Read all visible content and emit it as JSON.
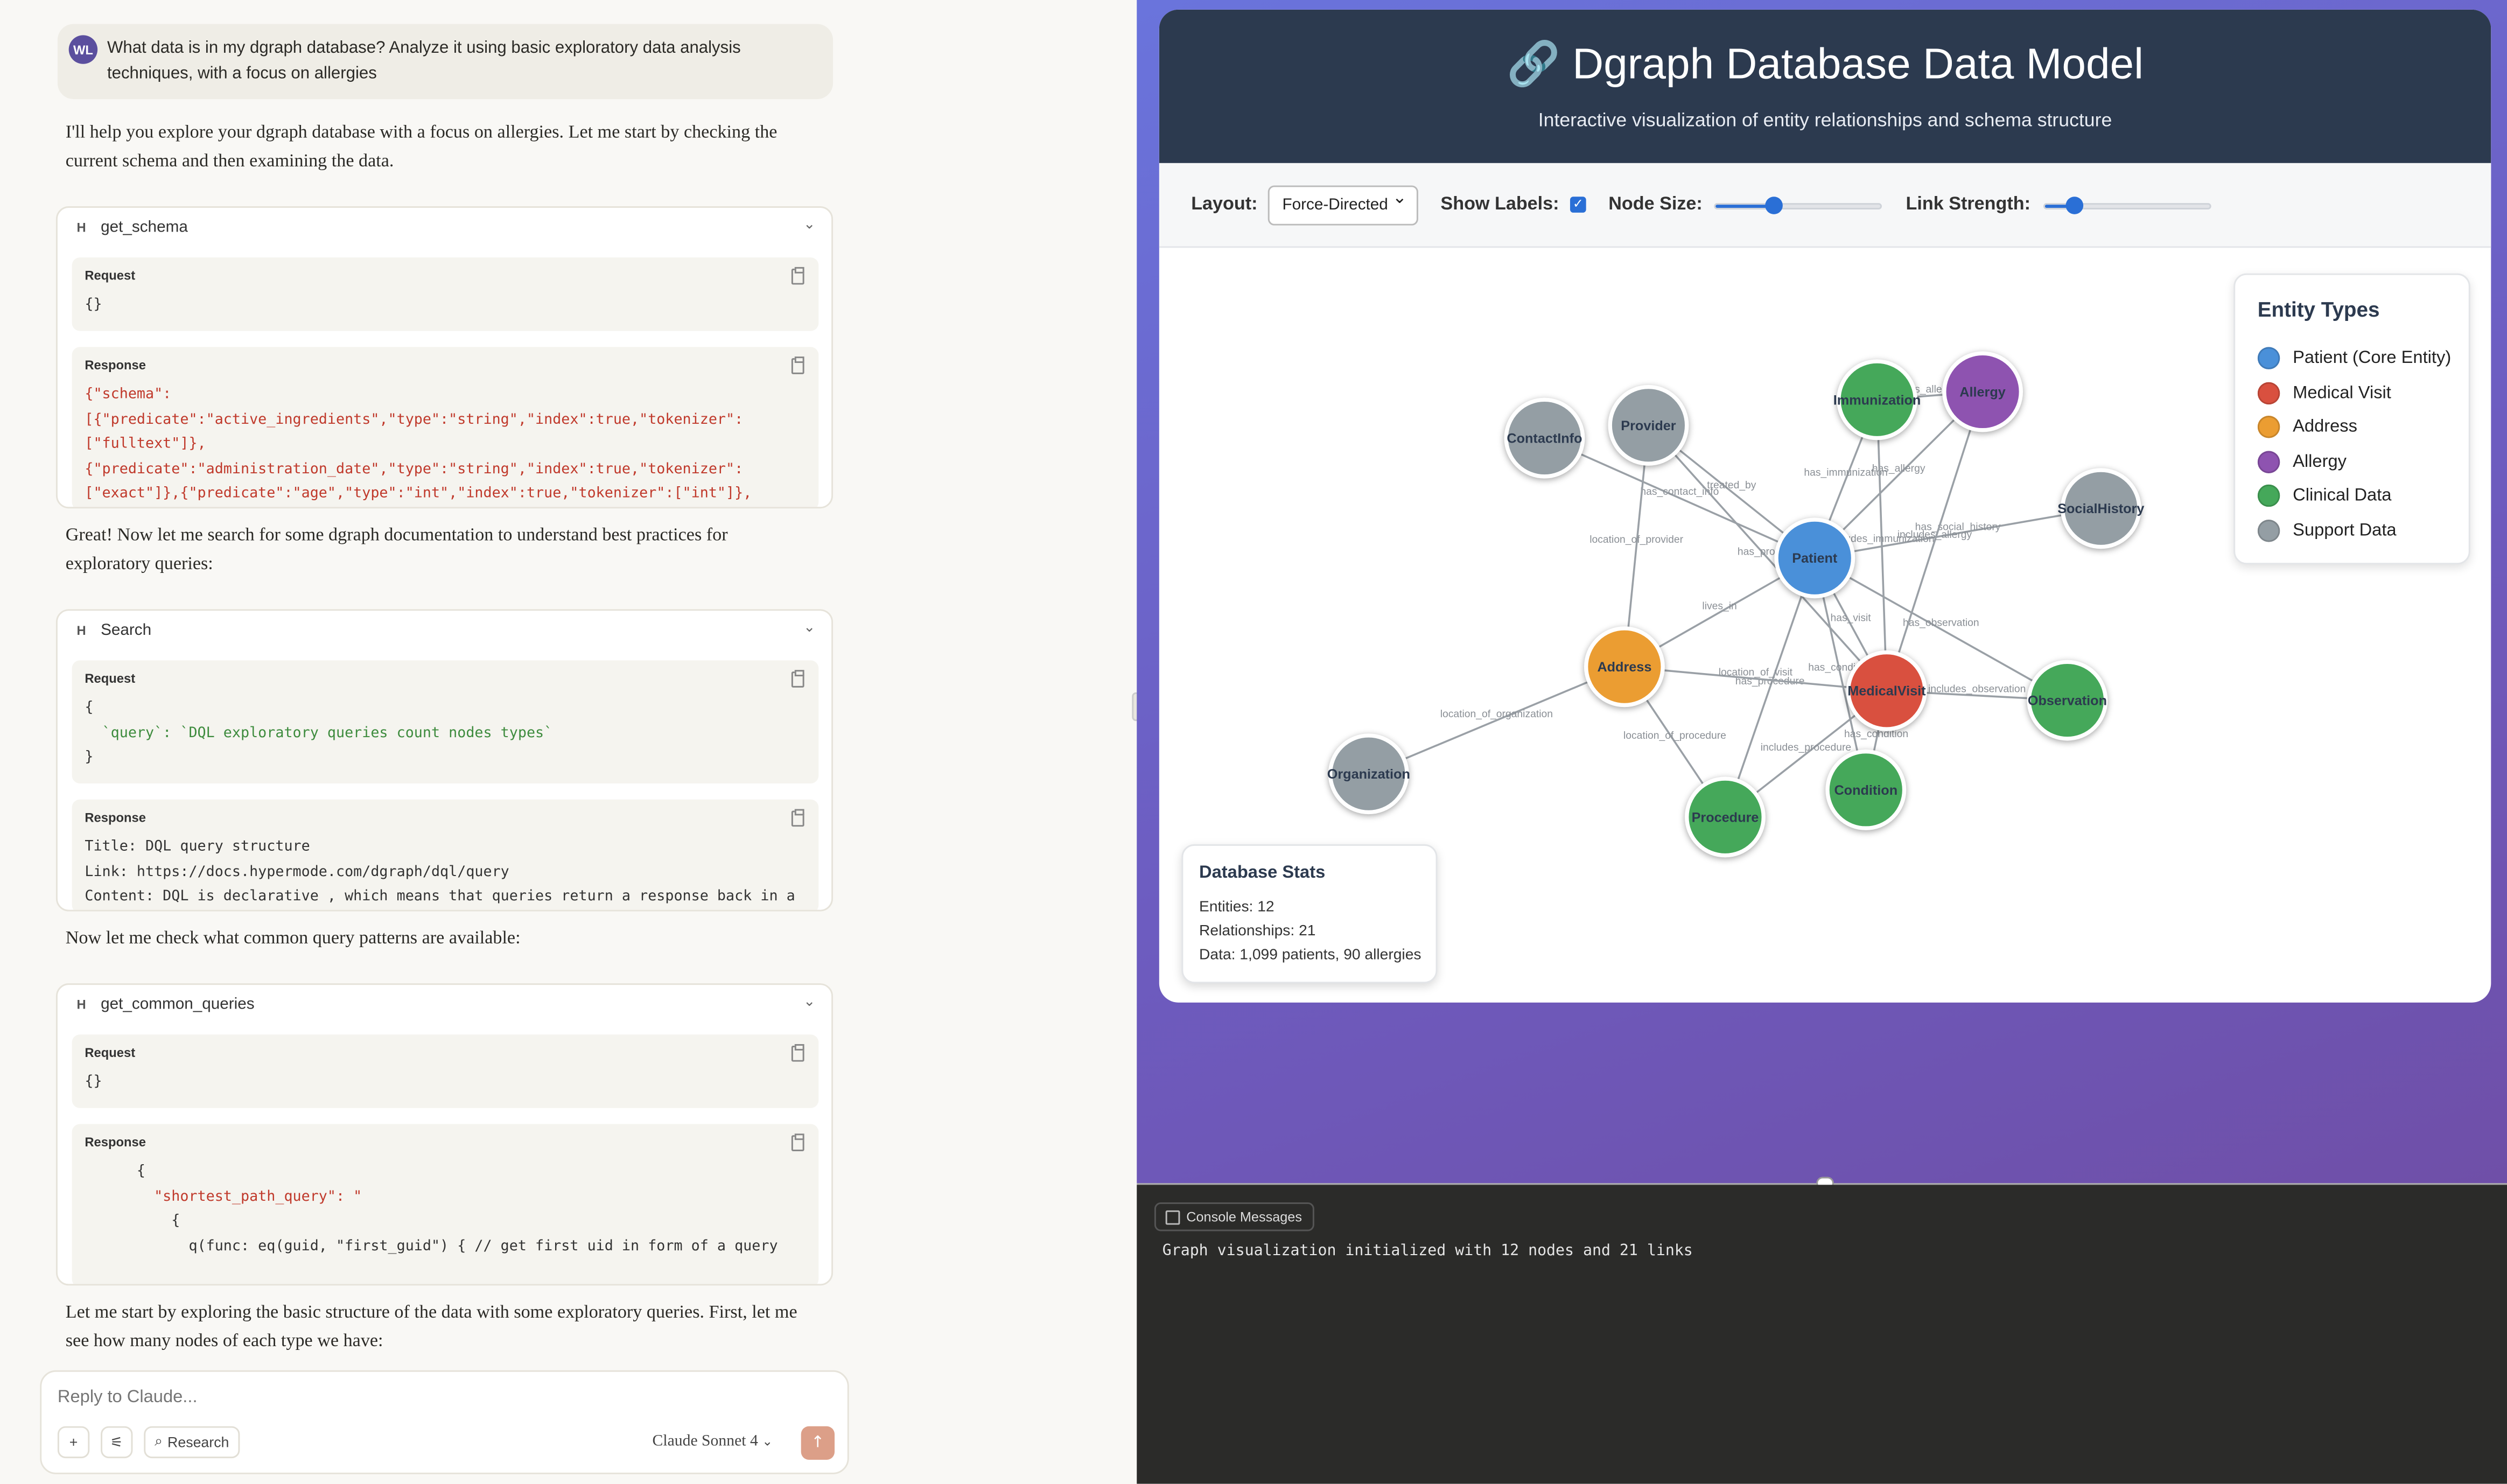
{
  "chat": {
    "user": {
      "initials": "WL",
      "message": "What data is in my dgraph database? Analyze it using basic exploratory data analysis techniques, with a focus on allergies"
    },
    "paragraphs": [
      "I'll help you explore your dgraph database with a focus on allergies. Let me start by checking the current schema and then examining the data.",
      "Great! Now let me search for some dgraph documentation to understand best practices for exploratory queries:",
      "Now let me check what common query patterns are available:",
      "Let me start by exploring the basic structure of the data with some exploratory queries. First, let me see how many nodes of each type we have:"
    ],
    "tools": [
      {
        "badge": "H",
        "name": "get_schema",
        "request_label": "Request",
        "response_label": "Response",
        "request_lines": [
          "{}"
        ],
        "response_lines": [
          "{\"schema\":",
          "[{\"predicate\":\"active_ingredients\",\"type\":\"string\",\"index\":true,\"tokenizer\":",
          "[\"fulltext\"]},",
          "{\"predicate\":\"administration_date\",\"type\":\"string\",\"index\":true,\"tokenizer\":",
          "[\"exact\"]},{\"predicate\":\"age\",\"type\":\"int\",\"index\":true,\"tokenizer\":[\"int\"]},"
        ]
      },
      {
        "badge": "H",
        "name": "Search",
        "request_label": "Request",
        "response_label": "Response",
        "request_lines": [
          "{",
          "  `query`: `DQL exploratory queries count nodes types`",
          "}"
        ],
        "response_lines": [
          "Title: DQL query structure",
          "Link: https://docs.hypermode.com/dgraph/dql/query",
          "Content: DQL is declarative , which means that queries return a response back in a"
        ]
      },
      {
        "badge": "H",
        "name": "get_common_queries",
        "request_label": "Request",
        "response_label": "Response",
        "request_lines": [
          "{}"
        ],
        "response_lines": [
          "",
          "      {",
          "        \"shortest_path_query\": \"",
          "          {",
          "            q(func: eq(guid, \"first_guid\") { // get first uid in form of a query"
        ]
      }
    ],
    "reply_placeholder": "Reply to Claude...",
    "research_label": "Research",
    "model_label": "Claude Sonnet 4"
  },
  "viz": {
    "title": "🔗 Dgraph Database Data Model",
    "subtitle": "Interactive visualization of entity relationships and schema structure",
    "controls": {
      "layout_label": "Layout:",
      "layout_value": "Force-Directed",
      "labels_label": "Show Labels:",
      "labels_checked": true,
      "node_size_label": "Node Size:",
      "node_size_level": 0.35,
      "link_strength_label": "Link Strength:",
      "link_strength_level": 0.17
    },
    "legend": {
      "title": "Entity Types",
      "items": [
        {
          "label": "Patient (Core Entity)",
          "color": "#4a90d9"
        },
        {
          "label": "Medical Visit",
          "color": "#d9503f"
        },
        {
          "label": "Address",
          "color": "#eb9d32"
        },
        {
          "label": "Allergy",
          "color": "#8e53b0"
        },
        {
          "label": "Clinical Data",
          "color": "#45a85a"
        },
        {
          "label": "Support Data",
          "color": "#949ea4"
        }
      ]
    },
    "stats": {
      "title": "Database Stats",
      "lines": [
        "Entities: 12",
        "Relationships: 21",
        "Data: 1,099 patients, 90 allergies"
      ]
    },
    "graph": {
      "nodes": [
        {
          "id": "Patient",
          "group": "patient"
        },
        {
          "id": "MedicalVisit",
          "group": "visit"
        },
        {
          "id": "Address",
          "group": "address"
        },
        {
          "id": "Allergy",
          "group": "allergy"
        },
        {
          "id": "Immunization",
          "group": "clinical"
        },
        {
          "id": "Observation",
          "group": "clinical"
        },
        {
          "id": "Condition",
          "group": "clinical"
        },
        {
          "id": "Procedure",
          "group": "clinical"
        },
        {
          "id": "ContactInfo",
          "group": "support"
        },
        {
          "id": "Provider",
          "group": "support"
        },
        {
          "id": "SocialHistory",
          "group": "support"
        },
        {
          "id": "Organization",
          "group": "support"
        }
      ],
      "links": [
        {
          "source": "Patient",
          "target": "ContactInfo",
          "label": "has_contact_info"
        },
        {
          "source": "Patient",
          "target": "Provider",
          "label": "treated_by"
        },
        {
          "source": "Patient",
          "target": "Immunization",
          "label": "has_immunization"
        },
        {
          "source": "Patient",
          "target": "Allergy",
          "label": "has_allergy"
        },
        {
          "source": "Patient",
          "target": "SocialHistory",
          "label": "has_social_history"
        },
        {
          "source": "Patient",
          "target": "Address",
          "label": "lives_in"
        },
        {
          "source": "Patient",
          "target": "MedicalVisit",
          "label": "has_visit"
        },
        {
          "source": "Patient",
          "target": "Observation",
          "label": "has_observation"
        },
        {
          "source": "Patient",
          "target": "Condition",
          "label": "has_condition"
        },
        {
          "source": "Patient",
          "target": "Procedure",
          "label": "has_procedure"
        },
        {
          "source": "MedicalVisit",
          "target": "Immunization",
          "label": "includes_immunization"
        },
        {
          "source": "MedicalVisit",
          "target": "Allergy",
          "label": "includes_allergy"
        },
        {
          "source": "MedicalVisit",
          "target": "Observation",
          "label": "includes_observation"
        },
        {
          "source": "MedicalVisit",
          "target": "Condition",
          "label": "has_condition"
        },
        {
          "source": "MedicalVisit",
          "target": "Procedure",
          "label": "includes_procedure"
        },
        {
          "source": "MedicalVisit",
          "target": "Address",
          "label": "location_of_visit"
        },
        {
          "source": "Provider",
          "target": "Address",
          "label": "location_of_provider"
        },
        {
          "source": "Organization",
          "target": "Address",
          "label": "location_of_organization"
        },
        {
          "source": "Procedure",
          "target": "Address",
          "label": "location_of_procedure"
        },
        {
          "source": "MedicalVisit",
          "target": "Provider",
          "label": "has_provider"
        },
        {
          "source": "Immunization",
          "target": "Allergy",
          "label": "has_allergy"
        }
      ]
    }
  },
  "console": {
    "tab_label": "Console Messages",
    "message": "Graph visualization initialized with 12 nodes and 21 links"
  }
}
